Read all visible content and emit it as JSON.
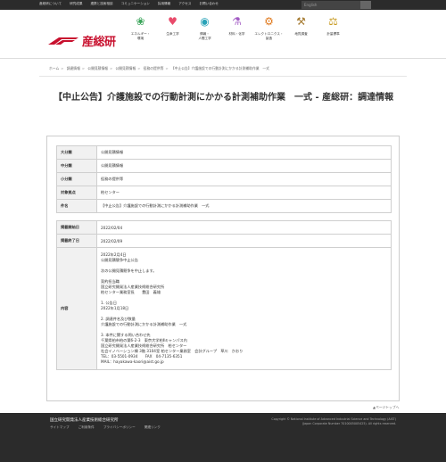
{
  "topbar": {
    "links": [
      "産総研について",
      "研究成果",
      "連携と技術相談",
      "コミュニケーション",
      "採用情報",
      "アクセス",
      "お問い合わせ"
    ],
    "search_placeholder": "English"
  },
  "logo": {
    "text": "産総研"
  },
  "nav": [
    {
      "label": "エネルギー・\n環境",
      "icon": "leaf-icon",
      "glyph": "❀",
      "color": "#3aa55a"
    },
    {
      "label": "生命工学",
      "icon": "heart-icon",
      "glyph": "♥",
      "color": "#e94b6b"
    },
    {
      "label": "情報・\n人間工学",
      "icon": "person-icon",
      "glyph": "◉",
      "color": "#2aa3b8"
    },
    {
      "label": "材料・化学",
      "icon": "flask-icon",
      "glyph": "⚗",
      "color": "#a35cc4"
    },
    {
      "label": "エレクトロニクス・\n製造",
      "icon": "gear-icon",
      "glyph": "⚙",
      "color": "#e07a1f"
    },
    {
      "label": "地質調査",
      "icon": "tools-icon",
      "glyph": "⚒",
      "color": "#a57a30"
    },
    {
      "label": "計量標準",
      "icon": "balance-icon",
      "glyph": "⚖",
      "color": "#c79a21"
    }
  ],
  "breadcrumb": [
    "ホーム",
    "調達情報",
    "公開見積情報",
    "公開見積情報",
    "役務の提供等",
    "【中止公告】介護施設での行動計測にかかる計測補助作業　一式"
  ],
  "title": "【中止公告】介護施設での行動計測にかかる計測補助作業　一式 - 産総研：調達情報",
  "table1": [
    {
      "key": "大分類",
      "value": "公開見積情報"
    },
    {
      "key": "中分類",
      "value": "公開見積情報"
    },
    {
      "key": "小分類",
      "value": "役務の提供等"
    },
    {
      "key": "対象拠点",
      "value": "柏センター"
    },
    {
      "key": "件名",
      "value": "【中止公告】介護施設での行動計測にかかる計測補助作業　一式"
    }
  ],
  "table2": [
    {
      "key": "掲載開始日",
      "value": "2022/02/04"
    },
    {
      "key": "掲載終了日",
      "value": "2022/02/09"
    }
  ],
  "content": {
    "key": "内容",
    "text": "2022年2月4日\n公開見積競争中止公告\n\n次の公開見積競争を中止します。\n\n契約担当職\n国立研究開発法人産業技術総合研究所\n柏センター業務室長　　豊田　義雄\n\n1. 公告日\n2022年1月18日\n\n2. 調達件名及び数量\n介護施設での行動計測にかかる計測補助作業　一式\n\n3. 本件に関する問い合わせ先\n千葉県柏市柏の葉6-2-3　東京大学柏Ⅱキャンパス内\n国立研究開発法人産業技術総合研究所　柏センター\n社会イノベーション棟 3階 3104室 柏センター業務室　会計グループ　草川　かおり\nTEL：03-5501-0934　　FAX　04-7135-6351\nMAIL：hayakawa-kaori@aist.go.jp"
  },
  "pagetop": "▲ページトップへ",
  "footer": {
    "org": "国立研究開発法人産業技術総合研究所",
    "links": [
      "サイトマップ",
      "ご利用条件",
      "プライバシーポリシー",
      "関連リンク"
    ],
    "copyright": "Copyright © National Institute of Advanced Industrial Science and Technology (AIST)\n(Japan Corporate Number 7010005005425). All rights reserved."
  }
}
